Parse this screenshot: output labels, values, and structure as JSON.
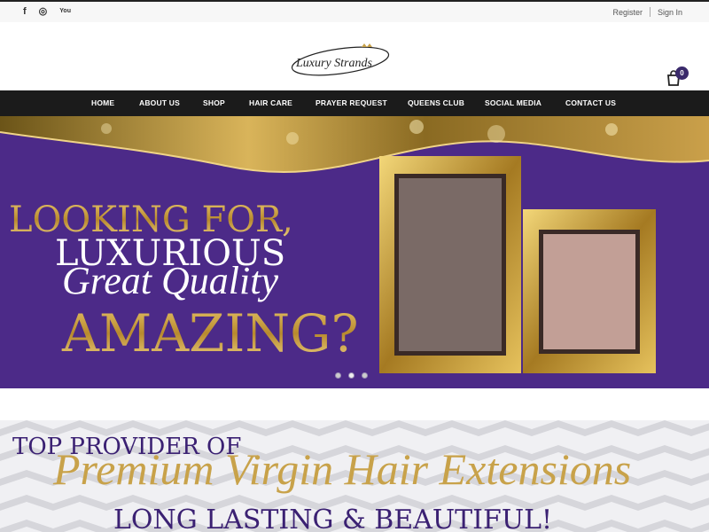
{
  "social": {
    "facebook_icon": "f",
    "instagram_icon": "◎",
    "youtube_icon": "You"
  },
  "auth": {
    "register_label": "Register",
    "signin_label": "Sign In"
  },
  "logo": {
    "text": "Luxury Strands"
  },
  "cart": {
    "count": "0"
  },
  "nav": {
    "items": [
      "HOME",
      "ABOUT US",
      "SHOP",
      "HAIR CARE",
      "PRAYER REQUEST",
      "QUEENS CLUB",
      "SOCIAL MEDIA",
      "CONTACT US"
    ]
  },
  "hero": {
    "line1": "LOOKING FOR,",
    "line2": "LUXURIOUS",
    "line3": "Great Quality",
    "line4": "AMAZING?",
    "slide_count": 3,
    "active_slide": 1
  },
  "promo": {
    "line1": "TOP PROVIDER OF",
    "line2": "Premium Virgin Hair Extensions",
    "line3": "LONG LASTING & BEAUTIFUL!"
  },
  "colors": {
    "purple": "#4c2a88",
    "gold": "#c8a24a",
    "nav_bg": "#1b1b1b"
  }
}
